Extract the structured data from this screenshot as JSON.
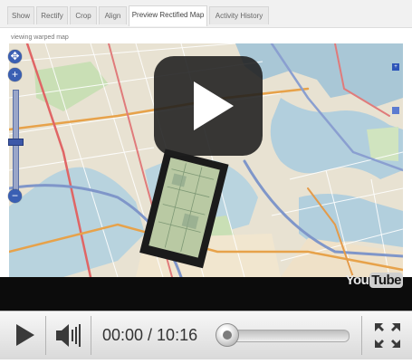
{
  "app": {
    "tabs": [
      {
        "label": "Show"
      },
      {
        "label": "Rectify"
      },
      {
        "label": "Crop"
      },
      {
        "label": "Align"
      },
      {
        "label": "Preview Rectified Map"
      },
      {
        "label": "Activity History"
      }
    ],
    "active_tab": "Preview Rectified Map",
    "viewing_label": "viewing warped map"
  },
  "map_controls": {
    "zoom_in": "+",
    "zoom_out": "−",
    "pan_icon": "pan-arrows-icon"
  },
  "video": {
    "overlay_icon": "play-icon",
    "logo_you": "You",
    "logo_tube": "Tube",
    "time_current": "00:00",
    "time_total": "10:16",
    "time_display": "00:00 / 10:16",
    "progress_fraction": 0,
    "play_icon": "play-icon",
    "volume_icon": "speaker-icon",
    "fullscreen_icon": "fullscreen-icon"
  },
  "colors": {
    "accent_blue": "#3a5fb3",
    "controls_bg": "#e6e6e6",
    "overlay_bg": "#1e1e1e"
  }
}
